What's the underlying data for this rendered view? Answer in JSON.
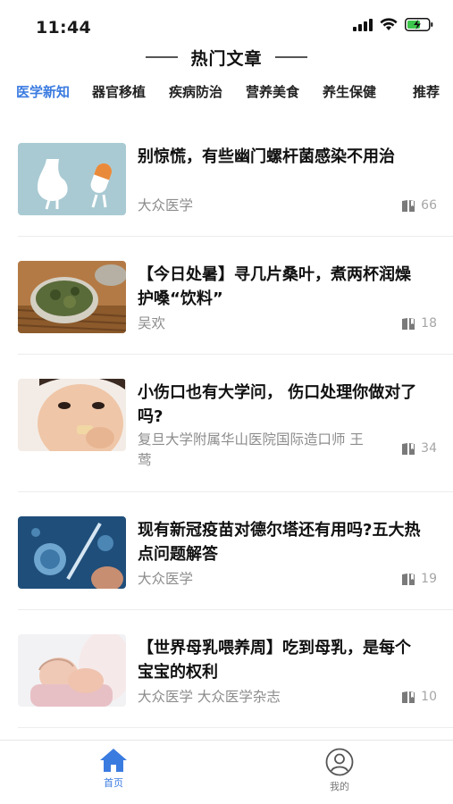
{
  "status_bar": {
    "time": "11:44"
  },
  "header": {
    "title": "热门文章"
  },
  "tabs": [
    {
      "label": "医学新知",
      "active": true
    },
    {
      "label": "器官移植",
      "active": false
    },
    {
      "label": "疾病防治",
      "active": false
    },
    {
      "label": "营养美食",
      "active": false
    },
    {
      "label": "养生保健",
      "active": false
    },
    {
      "label": "推荐",
      "active": false
    }
  ],
  "articles": [
    {
      "title": "别惊慌，有些幽门螺杆菌感染不用治",
      "source": "大众医学",
      "count": "66",
      "thumb": "stomach-pill-illustration"
    },
    {
      "title": "【今日处暑】寻几片桑叶，煮两杯润燥护嗓“饮料”",
      "source": "吴欢",
      "count": "18",
      "thumb": "mulberry-leaf-tea-photo"
    },
    {
      "title": "小伤口也有大学问， 伤口处理你做对了吗?",
      "source": "复旦大学附属华山医院国际造口师 王 莺",
      "count": "34",
      "thumb": "child-bandage-photo"
    },
    {
      "title": "现有新冠疫苗对德尔塔还有用吗?五大热点问题解答",
      "source": "大众医学",
      "count": "19",
      "thumb": "virus-vaccine-photo"
    },
    {
      "title": "【世界母乳喂养周】吃到母乳，是每个宝宝的权利",
      "source": "大众医学 大众医学杂志",
      "count": "10",
      "thumb": "breastfeeding-baby-photo"
    }
  ],
  "bottom_nav": [
    {
      "label": "首页",
      "icon": "home-icon",
      "active": true
    },
    {
      "label": "我的",
      "icon": "user-icon",
      "active": false
    }
  ],
  "colors": {
    "accent": "#3a7be0",
    "text": "#111111",
    "muted": "#8c8c8c",
    "divider": "#ececec"
  }
}
